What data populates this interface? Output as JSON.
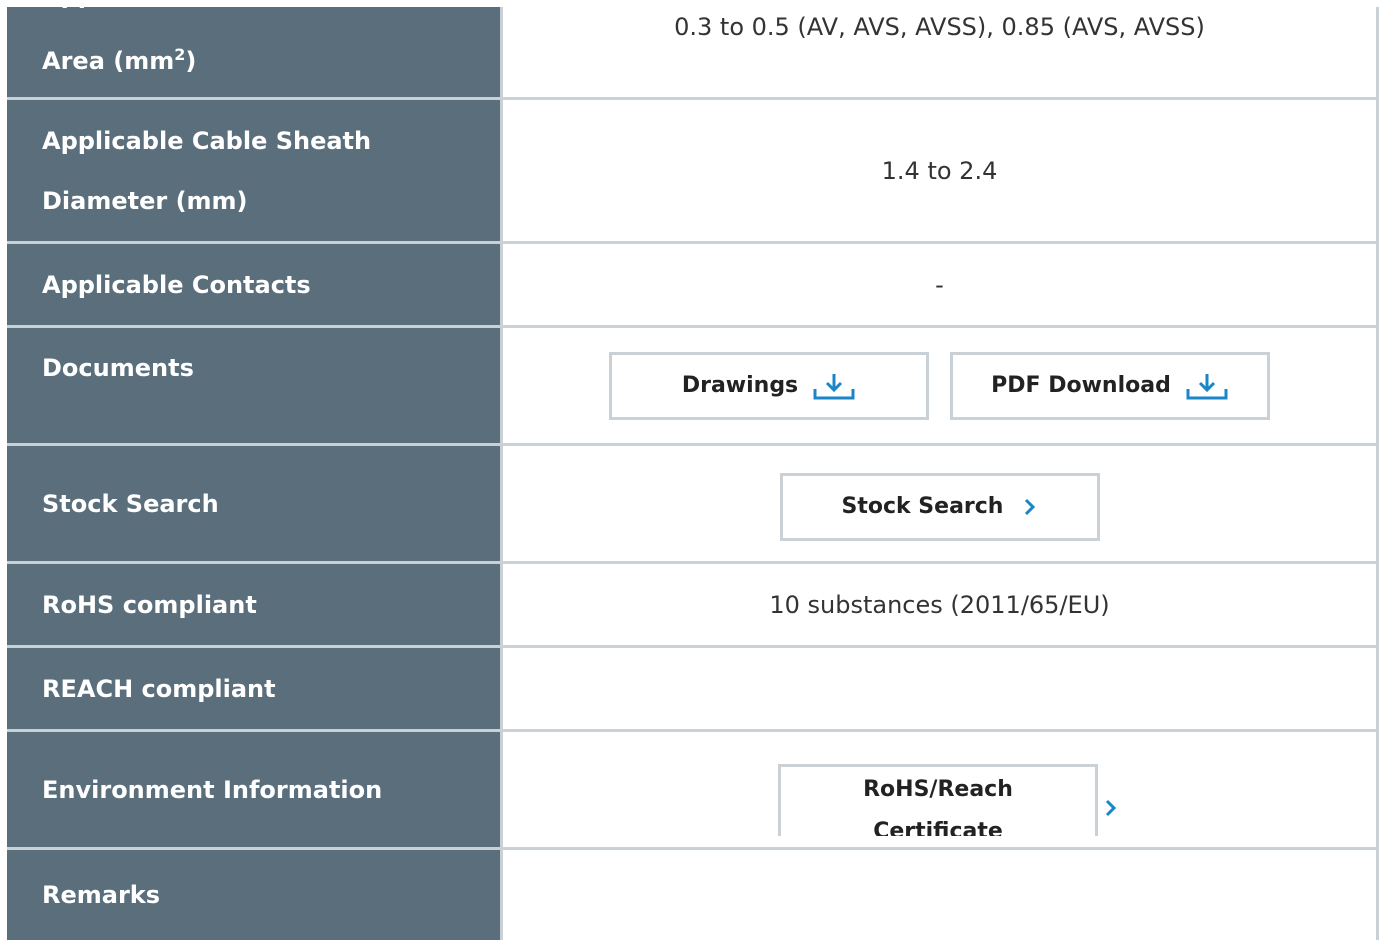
{
  "rows": {
    "area": {
      "label_line1": "Applicable Cable",
      "label_line2": "Area (mm",
      "label_sup": "2",
      "label_close": ")",
      "value": "0.3 to 0.5 (AV, AVS, AVSS), 0.85 (AVS, AVSS)"
    },
    "sheath": {
      "label_line1": "Applicable Cable Sheath",
      "label_line2": "Diameter (mm)",
      "value": "1.4 to 2.4"
    },
    "contacts": {
      "label": "Applicable Contacts",
      "value": "-"
    },
    "documents": {
      "label": "Documents",
      "drawings_label": "Drawings",
      "pdf_label": "PDF Download"
    },
    "stock": {
      "label": "Stock Search",
      "button_label": "Stock Search"
    },
    "rohs": {
      "label": "RoHS compliant",
      "value": "10 substances (2011/65/EU)"
    },
    "reach": {
      "label": "REACH compliant",
      "value": ""
    },
    "environment": {
      "label": "Environment Information",
      "button_line1": "RoHS/Reach",
      "button_line2": "Certificate"
    },
    "remarks": {
      "label": "Remarks",
      "value": ""
    }
  },
  "colors": {
    "label_bg": "#5a6e7c",
    "accent": "#1a86c8",
    "border": "#c9d0d6"
  }
}
